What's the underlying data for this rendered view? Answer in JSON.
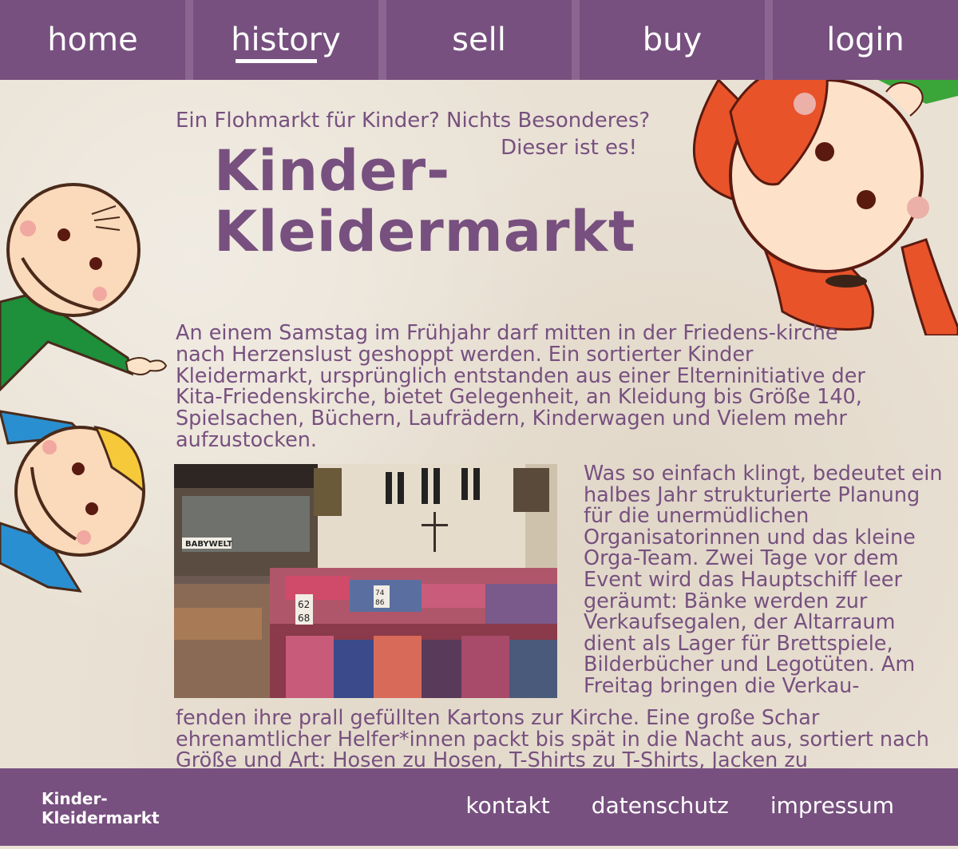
{
  "nav": {
    "items": [
      {
        "label": "home"
      },
      {
        "label": "history",
        "active": true
      },
      {
        "label": "sell"
      },
      {
        "label": "buy"
      },
      {
        "label": "login"
      }
    ]
  },
  "hero": {
    "tagline_line1": "Ein Flohmarkt für Kinder? Nichts Besonderes?",
    "tagline_line2": "Dieser ist es!",
    "logo_line1": "Kinder-",
    "logo_line2": "Kleidermarkt"
  },
  "content": {
    "paragraph1": "An einem Samstag im Frühjahr darf mitten in der Friedens-kirche nach Herzenslust geshoppt werden. Ein sortierter Kinder Kleidermarkt, ursprünglich entstanden aus einer Elterninitiative der Kita-Friedenskirche, bietet Gelegenheit, an Kleidung bis Größe 140, Spielsachen, Büchern, Laufrädern, Kinderwagen und Vielem mehr aufzustocken.",
    "paragraph2": "Was so einfach klingt, bedeutet ein halbes Jahr strukturierte Planung für die unermüdlichen Organisatorinnen und das kleine Orga-Team. Zwei Tage vor dem Event wird das Hauptschiff leer geräumt: Bänke werden zur Verkaufsegalen, der Altarraum dient als Lager für Brettspiele, Bilderbücher und Legotüten. Am Freitag bringen die Verkau-",
    "paragraph3": "fenden ihre prall gefüllten Kartons zur Kirche. Eine große Schar ehrenamtlicher Helfer*innen packt bis spät in die Nacht aus, sortiert nach Größe und Art: Hosen zu Hosen, T-Shirts zu T-Shirts, Jacken zu",
    "photo": {
      "sign_babywelt": "BABYWELT",
      "sign_a": "62",
      "sign_b": "68",
      "sign_c": "74",
      "sign_d": "86"
    }
  },
  "footer": {
    "logo_line1": "Kinder-",
    "logo_line2": "Kleidermarkt",
    "links": [
      {
        "label": "kontakt"
      },
      {
        "label": "datenschutz"
      },
      {
        "label": "impressum"
      }
    ]
  },
  "colors": {
    "brand_purple": "#77507f",
    "paper": "#e9e1d4",
    "white": "#ffffff"
  }
}
